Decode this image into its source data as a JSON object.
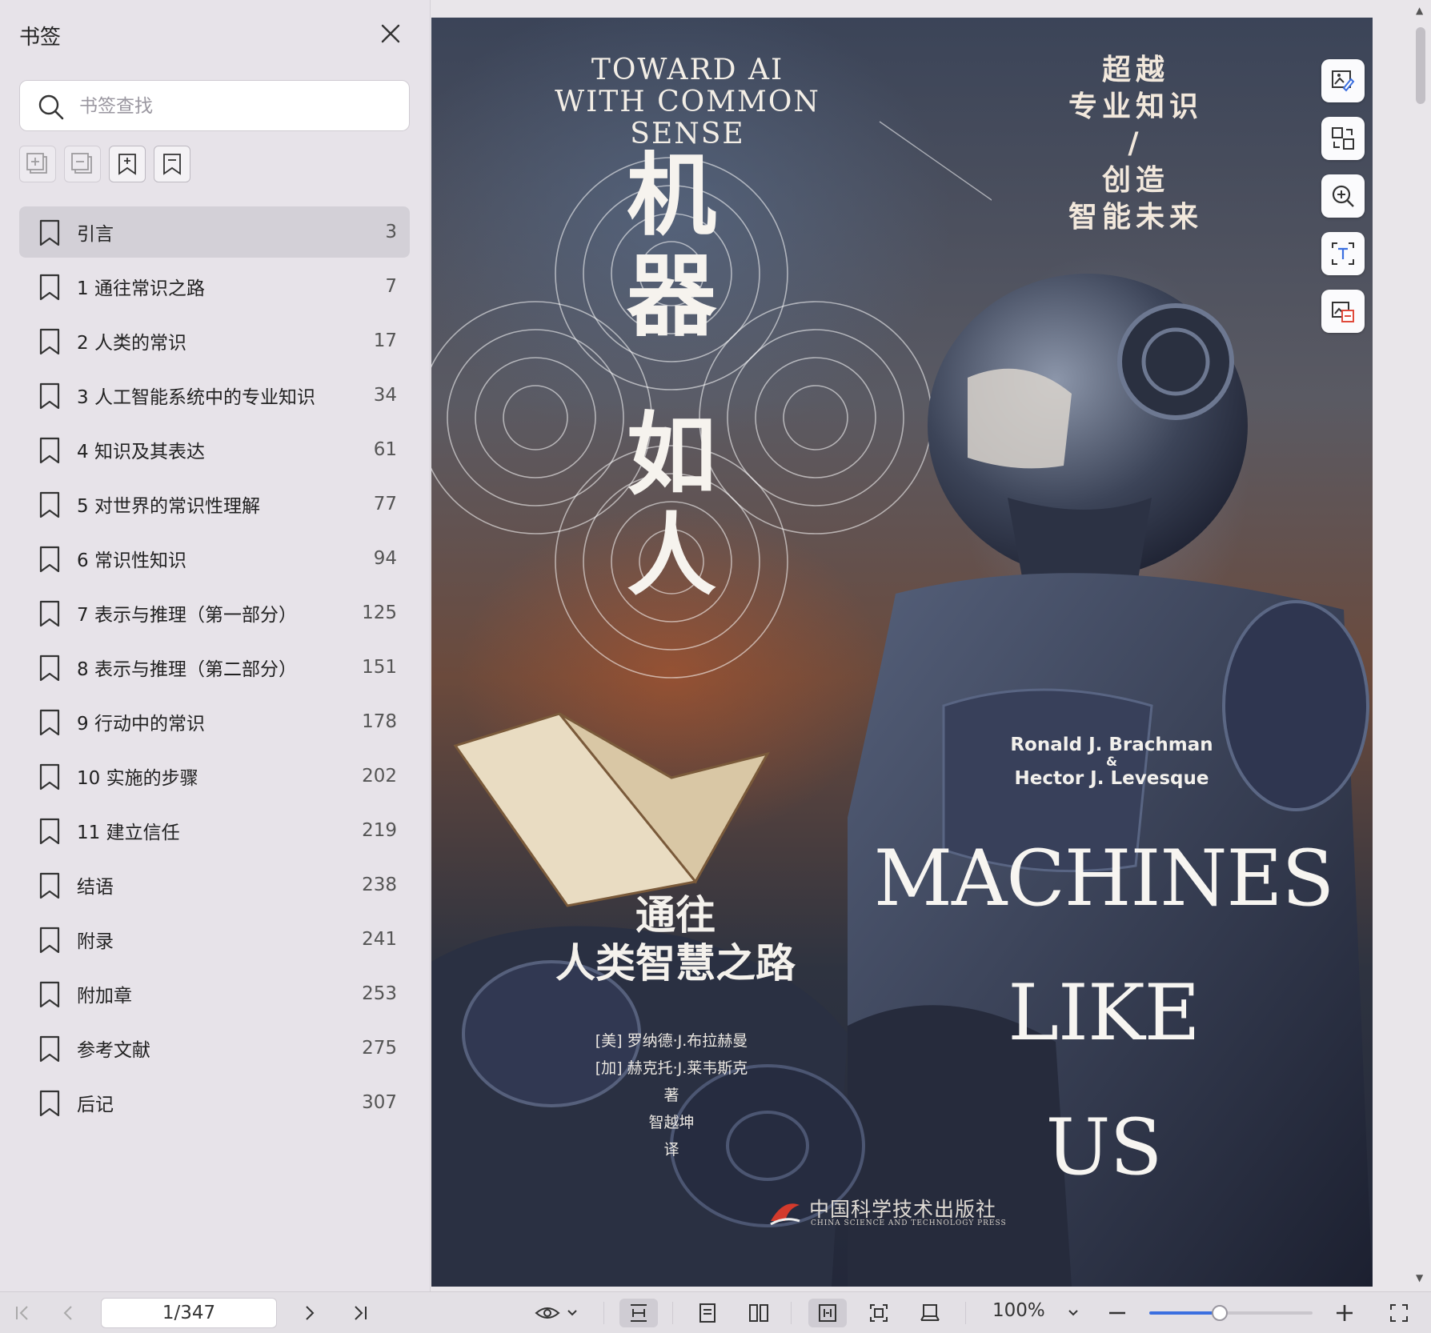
{
  "sidebar": {
    "title": "书签",
    "search_placeholder": "书签查找",
    "tools": [
      "expand-all-icon",
      "collapse-all-icon",
      "add-bookmark-icon",
      "bookmark-icon"
    ],
    "items": [
      {
        "label": "引言",
        "page": "3",
        "active": true
      },
      {
        "label": "1 通往常识之路",
        "page": "7"
      },
      {
        "label": "2 人类的常识",
        "page": "17"
      },
      {
        "label": "3 人工智能系统中的专业知识",
        "page": "34"
      },
      {
        "label": "4 知识及其表达",
        "page": "61"
      },
      {
        "label": "5 对世界的常识性理解",
        "page": "77"
      },
      {
        "label": "6 常识性知识",
        "page": "94"
      },
      {
        "label": "7 表示与推理（第一部分）",
        "page": "125"
      },
      {
        "label": "8 表示与推理（第二部分）",
        "page": "151"
      },
      {
        "label": "9 行动中的常识",
        "page": "178"
      },
      {
        "label": "10 实施的步骤",
        "page": "202"
      },
      {
        "label": "11 建立信任",
        "page": "219"
      },
      {
        "label": "结语",
        "page": "238"
      },
      {
        "label": "附录",
        "page": "241"
      },
      {
        "label": "附加章",
        "page": "253"
      },
      {
        "label": "参考文献",
        "page": "275"
      },
      {
        "label": "后记",
        "page": "307"
      }
    ]
  },
  "cover": {
    "en_title_line1": "TOWARD AI",
    "en_title_line2": "WITH COMMON SENSE",
    "tagline_lines": [
      "超越",
      "专业知识",
      "/",
      "创造",
      "智能未来"
    ],
    "zh_title_chars": [
      "机",
      "器",
      "如",
      "人"
    ],
    "author1_en": "Ronald J. Brachman",
    "amp": "&",
    "author2_en": "Hector J. Levesque",
    "en_big": [
      "MACHINES",
      "LIKE",
      "US"
    ],
    "subtitle_line1": "通往",
    "subtitle_line2": "人类智慧之路",
    "credits": [
      "[美] 罗纳德·J.布拉赫曼",
      "[加] 赫克托·J.莱韦斯克",
      "著",
      "智越坤",
      "译"
    ],
    "publisher_zh": "中国科学技术出版社",
    "publisher_en": "CHINA SCIENCE AND TECHNOLOGY PRESS"
  },
  "side_tools": [
    "image-edit-icon",
    "translate-icon",
    "zoom-in-icon",
    "ocr-text-icon",
    "image-extract-icon"
  ],
  "bottom": {
    "page_indicator": "1/347",
    "zoom": "100%",
    "zoom_fraction": 0.43
  },
  "colors": {
    "accent": "#3b6fe0",
    "sidebar_bg": "#e7e3e9",
    "active_item": "#d3d0d7"
  }
}
